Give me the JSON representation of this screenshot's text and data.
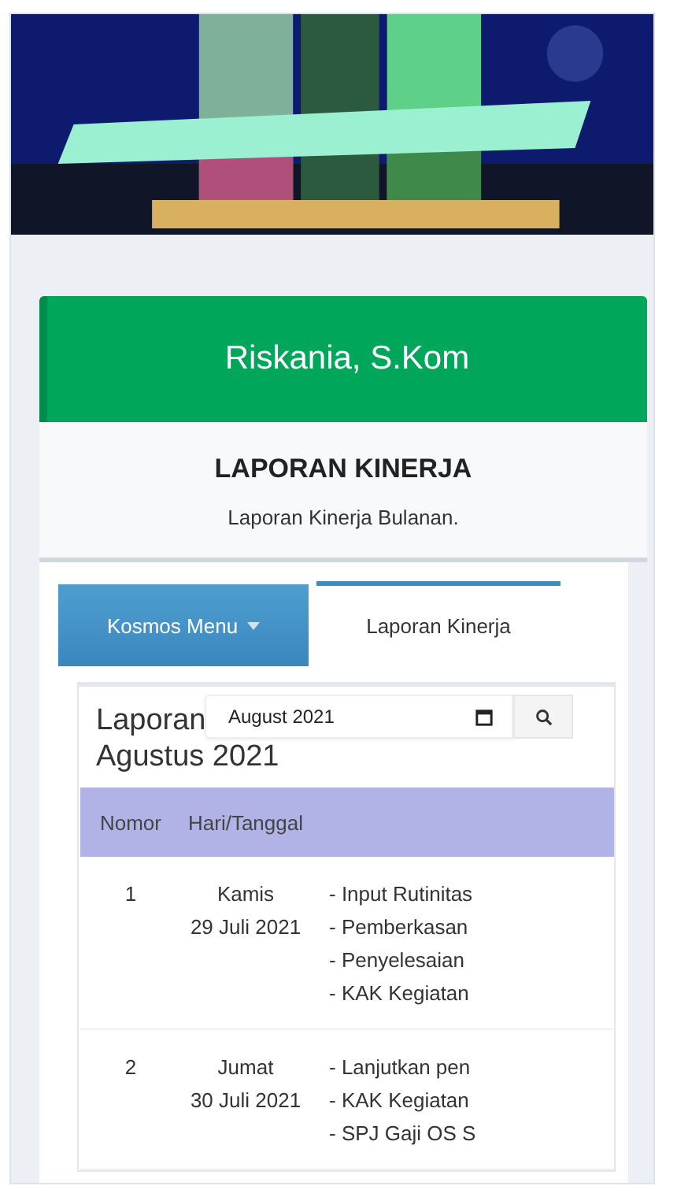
{
  "user": {
    "name": "Riskania, S.Kom"
  },
  "page": {
    "title": "LAPORAN KINERJA",
    "subtitle": "Laporan Kinerja Bulanan."
  },
  "tabs": [
    {
      "label": "Kosmos Menu",
      "kind": "menu",
      "selected": false
    },
    {
      "label": "Laporan Kinerja",
      "kind": "tab",
      "selected": true
    }
  ],
  "report": {
    "heading": [
      "Laporan",
      "Agustus 2021"
    ],
    "month_field": {
      "value": "August 2021"
    }
  },
  "table": {
    "columns": [
      "Nomor",
      "Hari/Tanggal"
    ],
    "rows": [
      {
        "no": "1",
        "day": "Kamis",
        "date": "29 Juli 2021",
        "tasks": [
          "- Input Rutinitas",
          "- Pemberkasan",
          "- Penyelesaian",
          "- KAK Kegiatan"
        ]
      },
      {
        "no": "2",
        "day": "Jumat",
        "date": "30 Juli 2021",
        "tasks": [
          "- Lanjutkan pen",
          "- KAK Kegiatan",
          "- SPJ Gaji OS S"
        ]
      }
    ]
  }
}
